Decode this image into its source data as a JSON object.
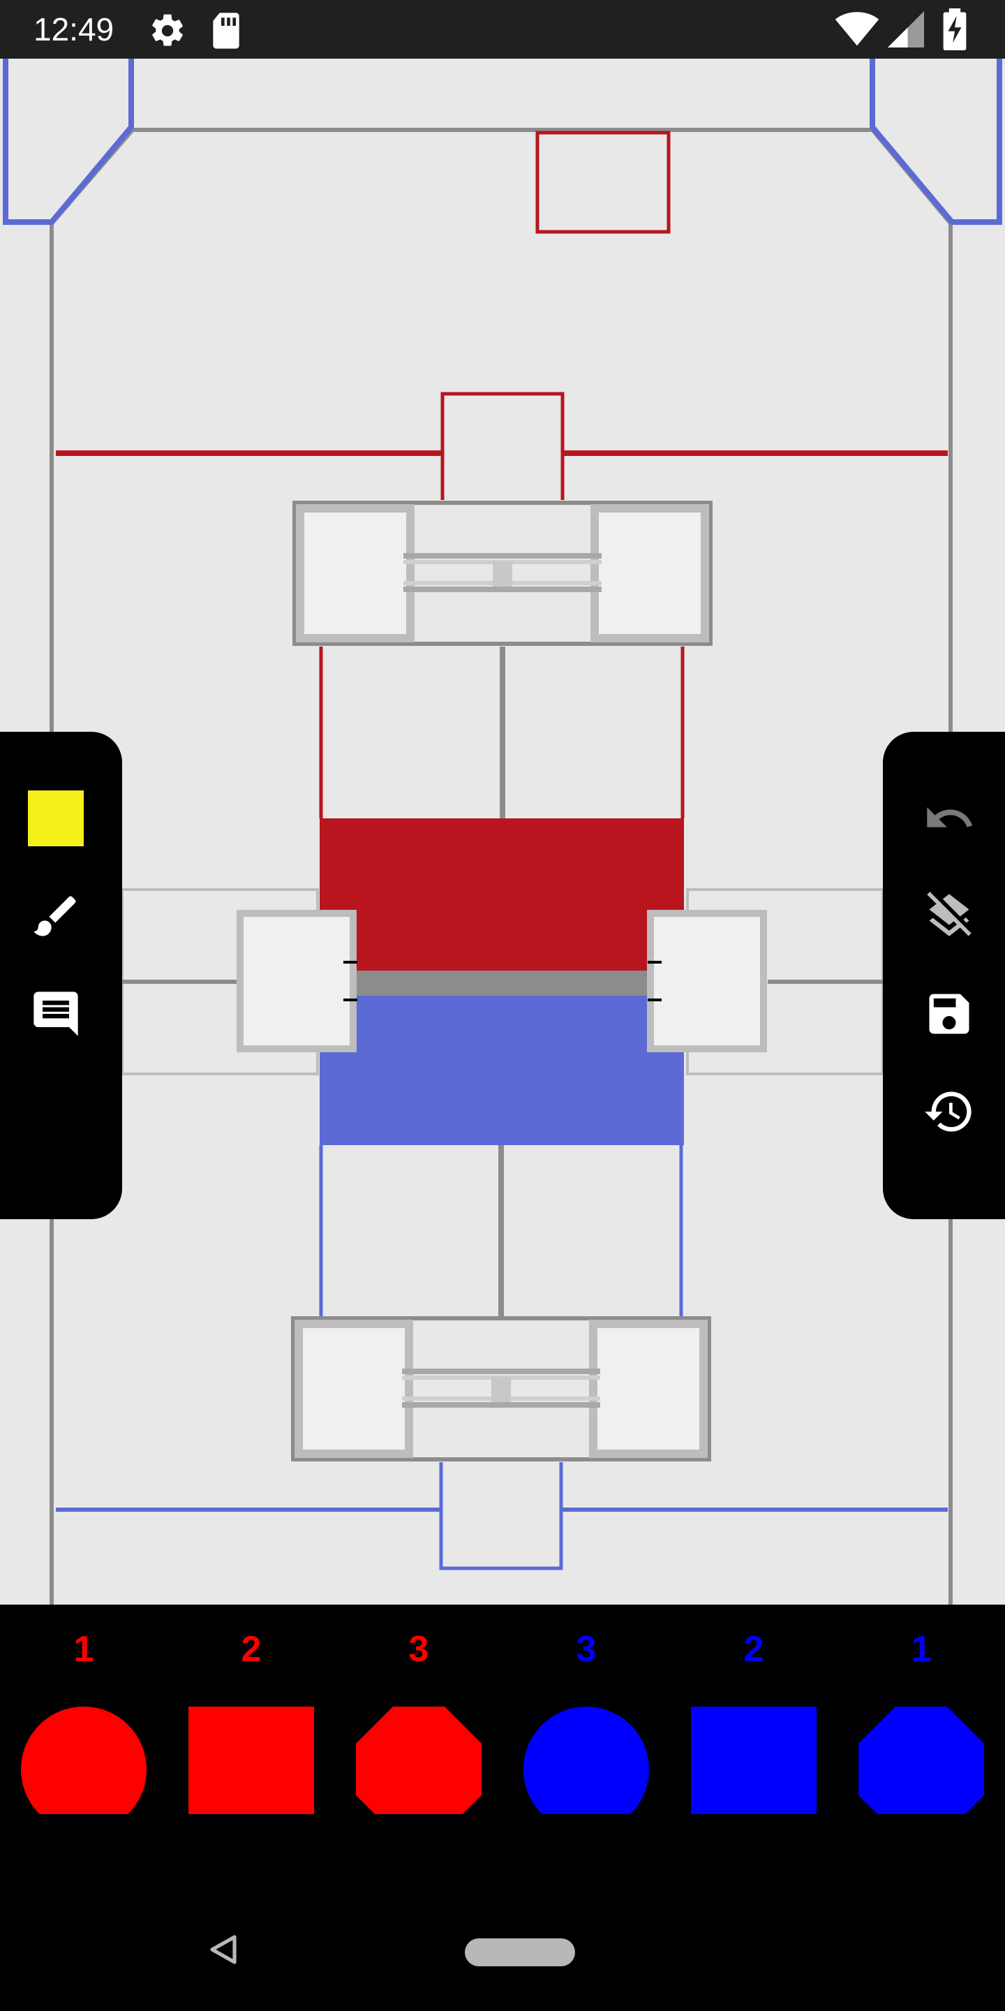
{
  "status_bar": {
    "time": "12:49",
    "left_icons": [
      "gear-icon",
      "sd-card-icon"
    ],
    "right_icons": [
      "wifi-icon",
      "signal-icon",
      "battery-charging-icon"
    ]
  },
  "field": {
    "name": "game-field",
    "colors": {
      "red": "#b8151f",
      "blue": "#5c6ad6",
      "gray": "#8c8c8c",
      "light_gray": "#bdbdbd",
      "background": "#e8e8e8"
    }
  },
  "left_panel": {
    "selected_color": "#f5ef1a",
    "tools": [
      "color-swatch",
      "brush-icon",
      "comment-icon"
    ]
  },
  "right_panel": {
    "tools": [
      "undo-icon",
      "clear-layers-icon",
      "save-icon",
      "history-icon"
    ]
  },
  "bottom_bar": {
    "items": [
      {
        "count": "1",
        "shape": "circle",
        "color": "#ff0000"
      },
      {
        "count": "2",
        "shape": "square",
        "color": "#ff0000"
      },
      {
        "count": "3",
        "shape": "octagon",
        "color": "#ff0000"
      },
      {
        "count": "3",
        "shape": "circle",
        "color": "#0000ff"
      },
      {
        "count": "2",
        "shape": "square",
        "color": "#0000ff"
      },
      {
        "count": "1",
        "shape": "octagon",
        "color": "#0000ff"
      }
    ]
  },
  "nav_bar": {
    "icons": [
      "back-icon",
      "home-pill-icon"
    ]
  }
}
